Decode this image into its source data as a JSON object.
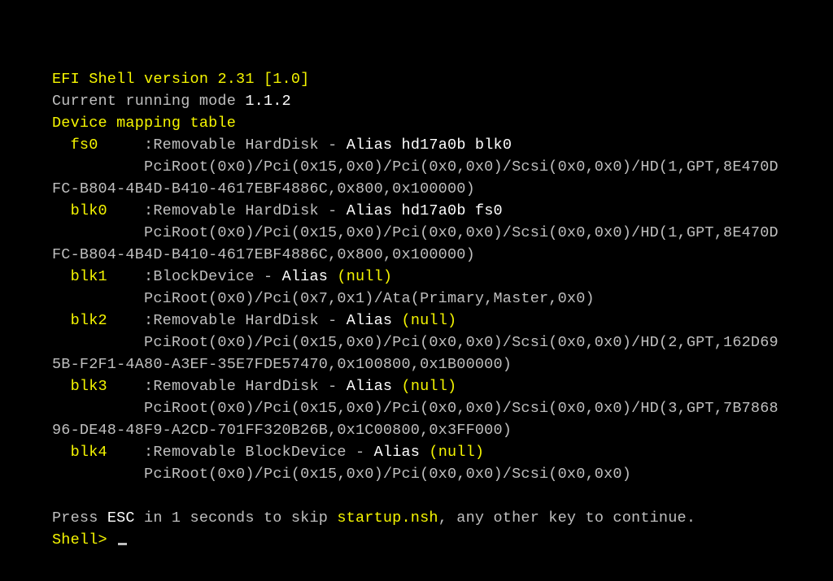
{
  "header": {
    "title_prefix": "EFI Shell version ",
    "version_a": "2.31",
    "version_b": " [1.0]",
    "mode_label": "Current running mode ",
    "mode_value": "1.1.2",
    "table_label": "Device mapping table"
  },
  "devices": [
    {
      "name": "fs0",
      "desc": "Removable HardDisk",
      "alias_word": "Alias",
      "alias_value": "hd17a0b blk0",
      "alias_null": false,
      "path_line1": "          PciRoot(0x0)/Pci(0x15,0x0)/Pci(0x0,0x0)/Scsi(0x0,0x0)/HD(1,GPT,8E470D",
      "path_line2": "FC-B804-4B4D-B410-4617EBF4886C,0x800,0x100000)"
    },
    {
      "name": "blk0",
      "desc": "Removable HardDisk",
      "alias_word": "Alias",
      "alias_value": "hd17a0b fs0",
      "alias_null": false,
      "path_line1": "          PciRoot(0x0)/Pci(0x15,0x0)/Pci(0x0,0x0)/Scsi(0x0,0x0)/HD(1,GPT,8E470D",
      "path_line2": "FC-B804-4B4D-B410-4617EBF4886C,0x800,0x100000)"
    },
    {
      "name": "blk1",
      "desc": "BlockDevice",
      "alias_word": "Alias",
      "alias_value": "(null)",
      "alias_null": true,
      "path_line1": "          PciRoot(0x0)/Pci(0x7,0x1)/Ata(Primary,Master,0x0)",
      "path_line2": ""
    },
    {
      "name": "blk2",
      "desc": "Removable HardDisk",
      "alias_word": "Alias",
      "alias_value": "(null)",
      "alias_null": true,
      "path_line1": "          PciRoot(0x0)/Pci(0x15,0x0)/Pci(0x0,0x0)/Scsi(0x0,0x0)/HD(2,GPT,162D69",
      "path_line2": "5B-F2F1-4A80-A3EF-35E7FDE57470,0x100800,0x1B00000)"
    },
    {
      "name": "blk3",
      "desc": "Removable HardDisk",
      "alias_word": "Alias",
      "alias_value": "(null)",
      "alias_null": true,
      "path_line1": "          PciRoot(0x0)/Pci(0x15,0x0)/Pci(0x0,0x0)/Scsi(0x0,0x0)/HD(3,GPT,7B7868",
      "path_line2": "96-DE48-48F9-A2CD-701FF320B26B,0x1C00800,0x3FF000)"
    },
    {
      "name": "blk4",
      "desc": "Removable BlockDevice",
      "alias_word": "Alias",
      "alias_value": "(null)",
      "alias_null": true,
      "path_line1": "          PciRoot(0x0)/Pci(0x15,0x0)/Pci(0x0,0x0)/Scsi(0x0,0x0)",
      "path_line2": ""
    }
  ],
  "footer": {
    "press_prefix": "Press ",
    "esc": "ESC",
    "press_mid": " in 1 seconds to skip ",
    "startup": "startup.nsh",
    "press_suffix": ", any other key to continue.",
    "prompt": "Shell> "
  }
}
